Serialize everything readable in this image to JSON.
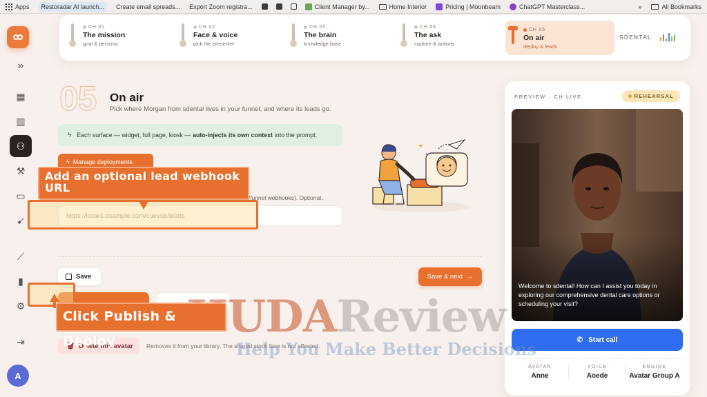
{
  "bookmarks": {
    "items": [
      {
        "label": "Apps",
        "icon": "apps-grid-icon"
      },
      {
        "label": "Restoradar AI launch...",
        "icon": "page-icon",
        "active": true
      },
      {
        "label": "Create email spreads...",
        "icon": "page-icon"
      },
      {
        "label": "Export Zoom registra...",
        "icon": "page-icon"
      }
    ],
    "more_items": [
      {
        "label": "Client Manager by...",
        "icon": "page-icon"
      },
      {
        "label": "Home Interior",
        "icon": "folder-icon"
      },
      {
        "label": "Pricing | Moonbeam",
        "icon": "page-icon"
      },
      {
        "label": "ChatGPT Masterclass...",
        "icon": "page-icon"
      }
    ],
    "overflow": "»",
    "all_bookmarks": "All Bookmarks"
  },
  "sidebar": {
    "items": [
      {
        "name": "collapse-icon",
        "glyph": "»"
      },
      {
        "name": "dashboard-icon",
        "glyph": "▦"
      },
      {
        "name": "buildings-icon",
        "glyph": "▥"
      },
      {
        "name": "users-icon",
        "glyph": "⚇",
        "active": true
      },
      {
        "name": "magic-wand-icon",
        "glyph": "⚒"
      },
      {
        "name": "video-icon",
        "glyph": "▭"
      },
      {
        "name": "rocket-icon",
        "glyph": "➹"
      },
      {
        "name": "trend-icon",
        "glyph": "⟋"
      },
      {
        "name": "bar-chart-icon",
        "glyph": "▮"
      },
      {
        "name": "settings-icon",
        "glyph": "⚙"
      },
      {
        "name": "logout-icon",
        "glyph": "⇥"
      }
    ],
    "avatar_initial": "A"
  },
  "chapters": [
    {
      "num": "CH 01",
      "title": "The mission",
      "sub": "goal & persona"
    },
    {
      "num": "CH 02",
      "title": "Face & voice",
      "sub": "pick the presenter"
    },
    {
      "num": "CH 03",
      "title": "The brain",
      "sub": "knowledge base"
    },
    {
      "num": "CH 04",
      "title": "The ask",
      "sub": "capture & actions"
    },
    {
      "num": "CH 05",
      "title": "On air",
      "sub": "deploy & leads",
      "active": true
    }
  ],
  "brand": "SDENTAL",
  "main": {
    "step_number": "05",
    "title": "On air",
    "subtitle": "Pick where Morgan from sdental lives in your funnel, and where its leads go.",
    "info": {
      "before": "Each surface — widget, full page, kiosk —",
      "bold": "auto-injects its own context",
      "after": "into the prompt."
    },
    "manage_label": "Manage deployments",
    "field_hint": "d/funnel webhooks). Optional.",
    "webhook_placeholder": "https://hooks.example.com/cuevue/leads",
    "save_label": "Save",
    "save_next_label": "Save & next",
    "delete_label": "Delete this avatar",
    "delete_note": "Removes it from your library. The shared stock face is not affected."
  },
  "preview": {
    "label": "PREVIEW · CH LIVE",
    "badge": "REHEARSAL",
    "caption": "Welcome to sdental! How can I assist you today in exploring our comprehensive dental care options or scheduling your visit?",
    "start_call": "Start call",
    "stats": [
      {
        "label": "AVATAR",
        "value": "Anne"
      },
      {
        "label": "VOICE",
        "value": "Aoede"
      },
      {
        "label": "ENGINE",
        "value": "Avatar Group A"
      }
    ]
  },
  "tutorial": {
    "callout_1": "Add an optional lead webhook URL",
    "callout_2": "Click Publish & Deploy"
  },
  "watermark": {
    "part_a": "HUDA",
    "part_b": "Review",
    "tagline": "Help You Make Better Decisions"
  },
  "colors": {
    "accent": "#e8702e",
    "call_button": "#2f6df0",
    "info_bg": "#dff0e3",
    "active_chapter_bg": "#fbe4d4"
  }
}
